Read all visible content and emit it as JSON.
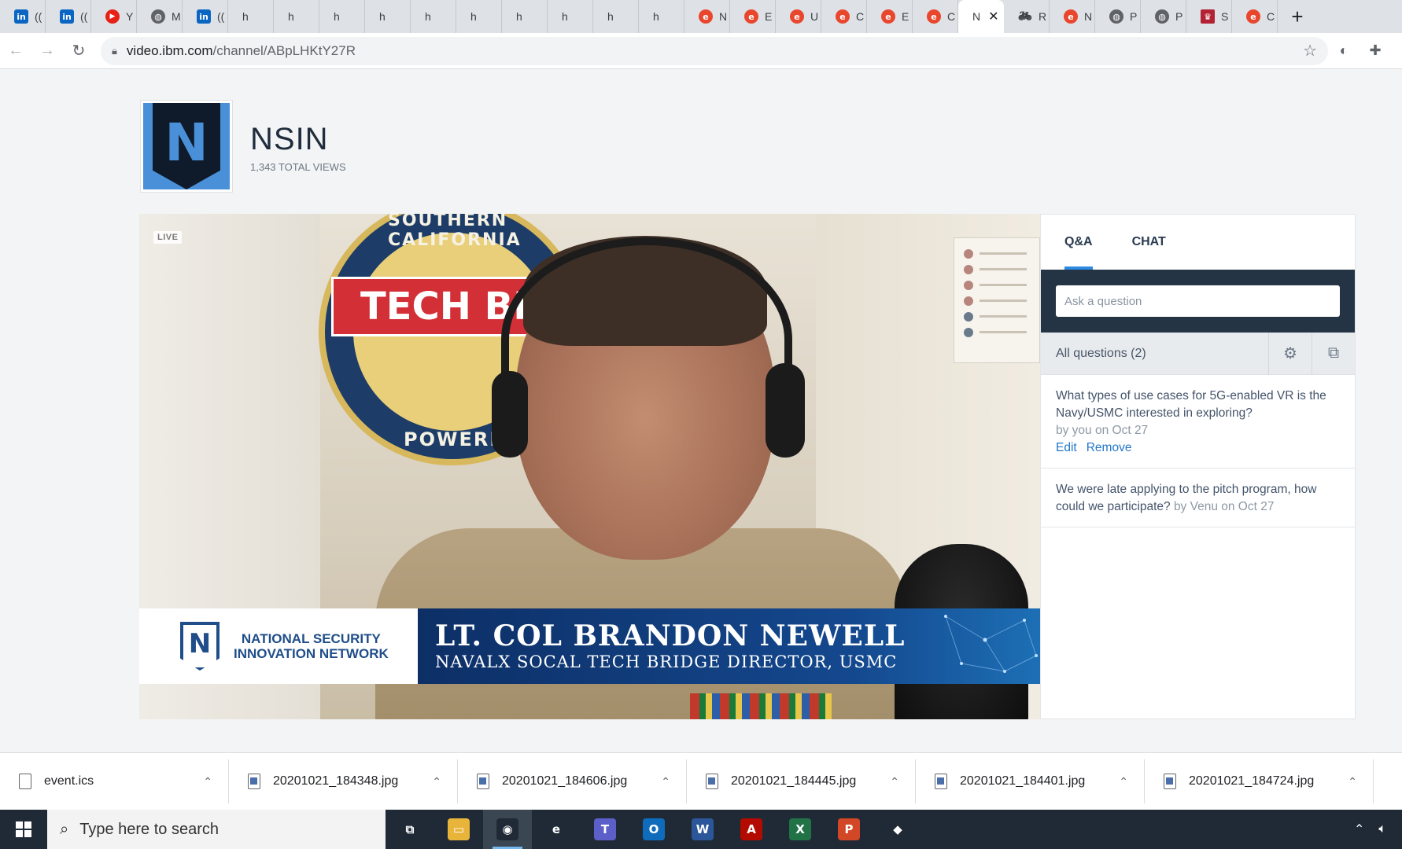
{
  "browser": {
    "tabs": [
      {
        "favicon": "linkedin-icon",
        "letter": "(("
      },
      {
        "favicon": "linkedin-icon",
        "letter": "(("
      },
      {
        "favicon": "youtube-icon",
        "letter": "Y"
      },
      {
        "favicon": "globe-icon",
        "letter": "M"
      },
      {
        "favicon": "linkedin-icon",
        "letter": "(("
      },
      {
        "favicon": "ibm-video-icon",
        "letter": "h"
      },
      {
        "favicon": "ibm-video-icon",
        "letter": "h"
      },
      {
        "favicon": "ibm-video-icon",
        "letter": "h"
      },
      {
        "favicon": "ibm-video-icon",
        "letter": "h"
      },
      {
        "favicon": "ibm-video-icon",
        "letter": "h"
      },
      {
        "favicon": "ibm-video-icon",
        "letter": "h"
      },
      {
        "favicon": "ibm-video-icon",
        "letter": "h"
      },
      {
        "favicon": "ibm-video-icon",
        "letter": "h"
      },
      {
        "favicon": "ibm-video-icon",
        "letter": "h"
      },
      {
        "favicon": "ibm-video-icon",
        "letter": "h"
      },
      {
        "favicon": "ibm-e-icon",
        "letter": "N"
      },
      {
        "favicon": "ibm-e-icon",
        "letter": "E"
      },
      {
        "favicon": "ibm-e-icon",
        "letter": "U"
      },
      {
        "favicon": "ibm-e-icon",
        "letter": "C"
      },
      {
        "favicon": "ibm-e-icon",
        "letter": "E"
      },
      {
        "favicon": "ibm-e-icon",
        "letter": "C"
      },
      {
        "favicon": "",
        "letter": "N",
        "active": true
      },
      {
        "favicon": "bicycle-icon",
        "letter": "R"
      },
      {
        "favicon": "ibm-e-icon",
        "letter": "N"
      },
      {
        "favicon": "globe-icon",
        "letter": "P"
      },
      {
        "favicon": "globe-icon",
        "letter": "P"
      },
      {
        "favicon": "hat-icon",
        "letter": "S"
      },
      {
        "favicon": "ibm-e-icon",
        "letter": "C"
      }
    ],
    "url_host": "video.ibm.com",
    "url_path": "/channel/ABpLHKtY27R"
  },
  "channel": {
    "logo_letter": "N",
    "name": "NSIN",
    "views": "1,343 TOTAL VIEWS"
  },
  "video": {
    "live_label": "LIVE",
    "seal_banner": "TECH BRI",
    "seal_top": "SOUTHERN CALIFORNIA",
    "seal_bottom": "POWERED BY",
    "lower_third": {
      "org": "NATIONAL SECURITY\nINNOVATION NETWORK",
      "name": "LT. COL BRANDON NEWELL",
      "title": "NAVALX SOCAL TECH BRIDGE DIRECTOR, USMC"
    }
  },
  "qa": {
    "tabs": [
      {
        "label": "Q&A",
        "active": true
      },
      {
        "label": "CHAT",
        "active": false
      }
    ],
    "ask_placeholder": "Ask a question",
    "filter_label": "All questions (2)",
    "questions": [
      {
        "text": "What types of use cases for 5G-enabled VR is the Navy/USMC interested in exploring?",
        "meta": "by you on Oct 27",
        "edit": "Edit",
        "remove": "Remove"
      },
      {
        "text": "We were late applying to the pitch program, how could we participate?",
        "meta": "by Venu on Oct 27"
      }
    ]
  },
  "downloads": [
    {
      "name": "event.ics",
      "icon": "calendar-file-icon"
    },
    {
      "name": "20201021_184348.jpg",
      "icon": "image-file-icon"
    },
    {
      "name": "20201021_184606.jpg",
      "icon": "image-file-icon"
    },
    {
      "name": "20201021_184445.jpg",
      "icon": "image-file-icon"
    },
    {
      "name": "20201021_184401.jpg",
      "icon": "image-file-icon"
    },
    {
      "name": "20201021_184724.jpg",
      "icon": "image-file-icon"
    }
  ],
  "taskbar": {
    "search_placeholder": "Type here to search",
    "apps": [
      {
        "name": "task-view",
        "color": "#1f2a36",
        "glyph": "⧉"
      },
      {
        "name": "file-explorer",
        "color": "#e8b43a",
        "glyph": "▭"
      },
      {
        "name": "chrome",
        "color": "#1f2a36",
        "glyph": "◉",
        "active": true
      },
      {
        "name": "internet-explorer",
        "color": "#1f2a36",
        "glyph": "e"
      },
      {
        "name": "teams",
        "color": "#5b5fc7",
        "glyph": "T"
      },
      {
        "name": "outlook",
        "color": "#0f6cbd",
        "glyph": "O"
      },
      {
        "name": "word",
        "color": "#2b579a",
        "glyph": "W"
      },
      {
        "name": "acrobat",
        "color": "#b30b00",
        "glyph": "A"
      },
      {
        "name": "excel",
        "color": "#217346",
        "glyph": "X"
      },
      {
        "name": "powerpoint",
        "color": "#d24726",
        "glyph": "P"
      },
      {
        "name": "paint",
        "color": "#1f2a36",
        "glyph": "◆"
      }
    ]
  }
}
